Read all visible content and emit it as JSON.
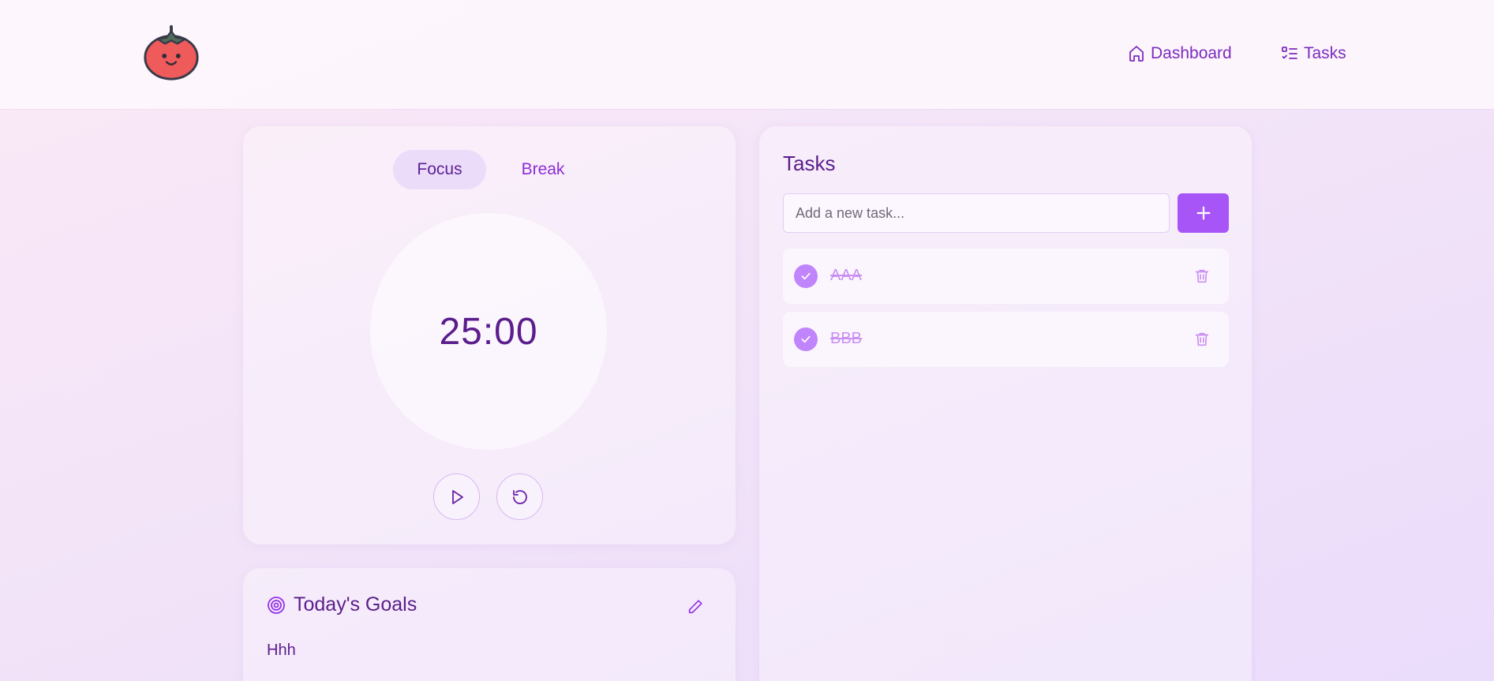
{
  "header": {
    "logo_icon": "tomato-icon",
    "nav": [
      {
        "label": "Dashboard",
        "icon": "home-icon"
      },
      {
        "label": "Tasks",
        "icon": "task-list-icon"
      }
    ]
  },
  "timer": {
    "tabs": [
      {
        "label": "Focus",
        "active": true
      },
      {
        "label": "Break",
        "active": false
      }
    ],
    "time": "25:00",
    "controls": [
      {
        "icon": "play-icon"
      },
      {
        "icon": "reset-icon"
      }
    ]
  },
  "goals": {
    "title": "Today's Goals",
    "icon": "target-icon",
    "edit_icon": "pencil-icon",
    "text": "Hhh"
  },
  "tasks": {
    "title": "Tasks",
    "input_placeholder": "Add a new task...",
    "add_icon": "plus-icon",
    "items": [
      {
        "label": "AAA",
        "completed": true
      },
      {
        "label": "BBB",
        "completed": true
      }
    ]
  },
  "colors": {
    "accent": "#a855f7",
    "text_primary": "#5b1d8c",
    "link": "#7b2cbf",
    "completed_text": "#c98ff3"
  }
}
